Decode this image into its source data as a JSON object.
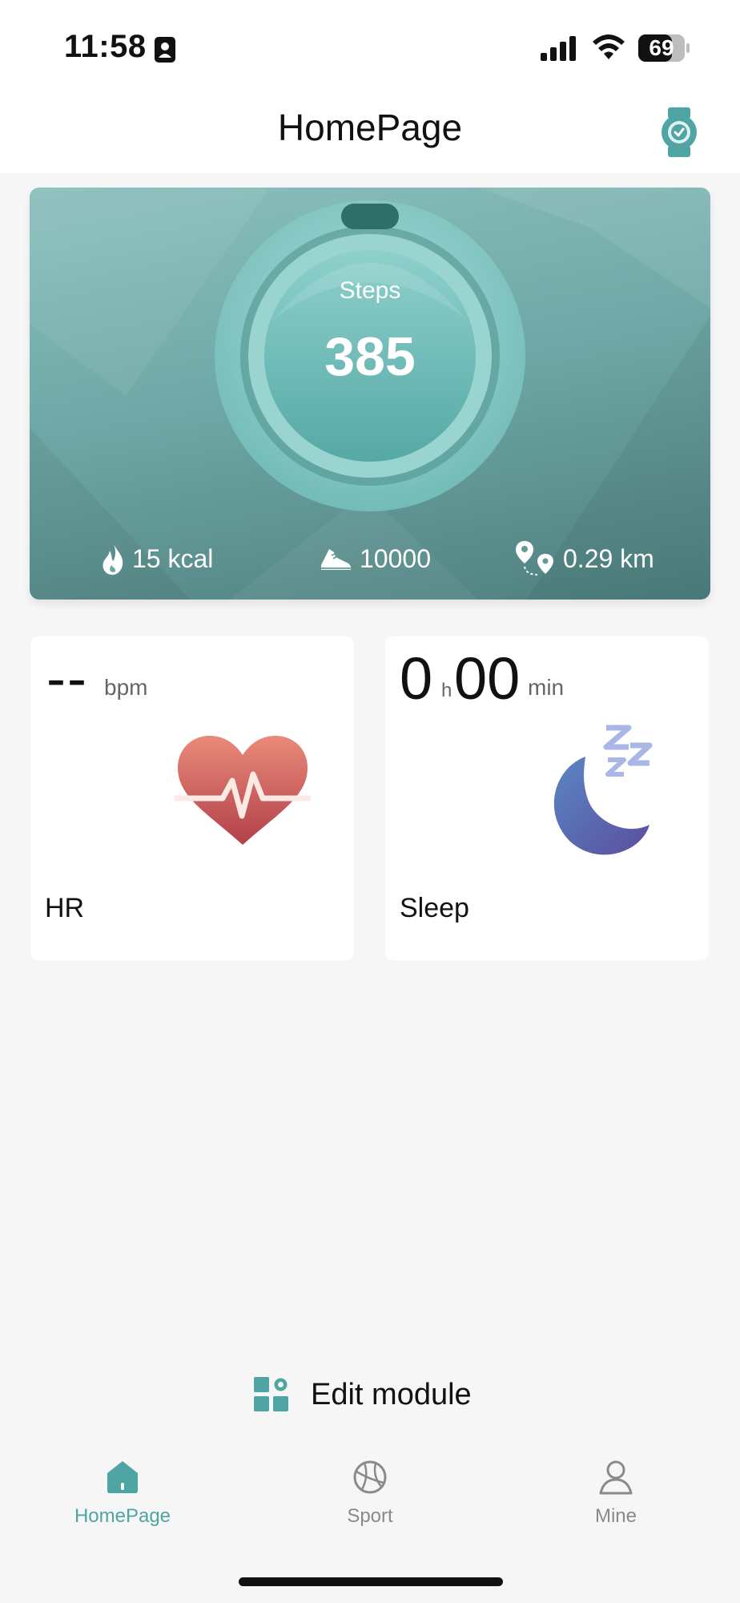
{
  "status_bar": {
    "time": "11:58",
    "battery": "69"
  },
  "header": {
    "title": "HomePage",
    "watch_icon": "watch-connected-icon"
  },
  "steps_card": {
    "label": "Steps",
    "value": "385",
    "stats": {
      "kcal": "15 kcal",
      "goal": "10000",
      "distance": "0.29 km"
    }
  },
  "tiles": {
    "hr": {
      "value": "--",
      "unit": "bpm",
      "label": "HR"
    },
    "sleep": {
      "hours": "0",
      "hours_unit": "h",
      "minutes": "00",
      "minutes_unit": "min",
      "label": "Sleep"
    }
  },
  "edit_module": {
    "label": "Edit module"
  },
  "tabs": [
    {
      "label": "HomePage",
      "active": true
    },
    {
      "label": "Sport",
      "active": false
    },
    {
      "label": "Mine",
      "active": false
    }
  ],
  "colors": {
    "accent": "#4fa5a4",
    "inactive": "#8a8a8a"
  }
}
